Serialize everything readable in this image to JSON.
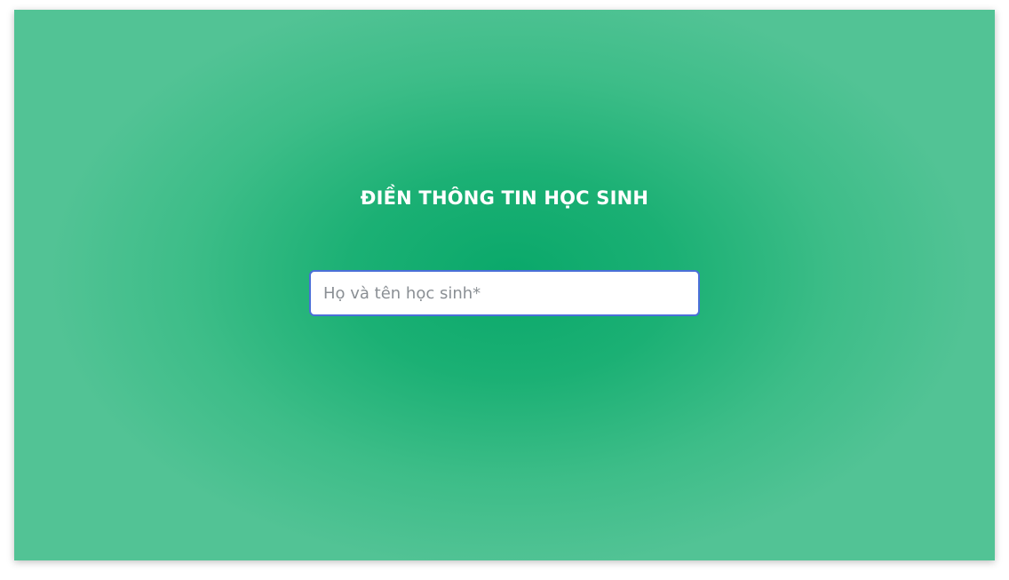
{
  "form": {
    "title": "ĐIỀN THÔNG TIN HỌC SINH",
    "name_field": {
      "placeholder": "Họ và tên học sinh*",
      "value": ""
    }
  },
  "colors": {
    "panel_center": "#0aa86a",
    "panel_edge": "#52c395",
    "input_border": "#4a6fd8",
    "title_text": "#ffffff"
  }
}
